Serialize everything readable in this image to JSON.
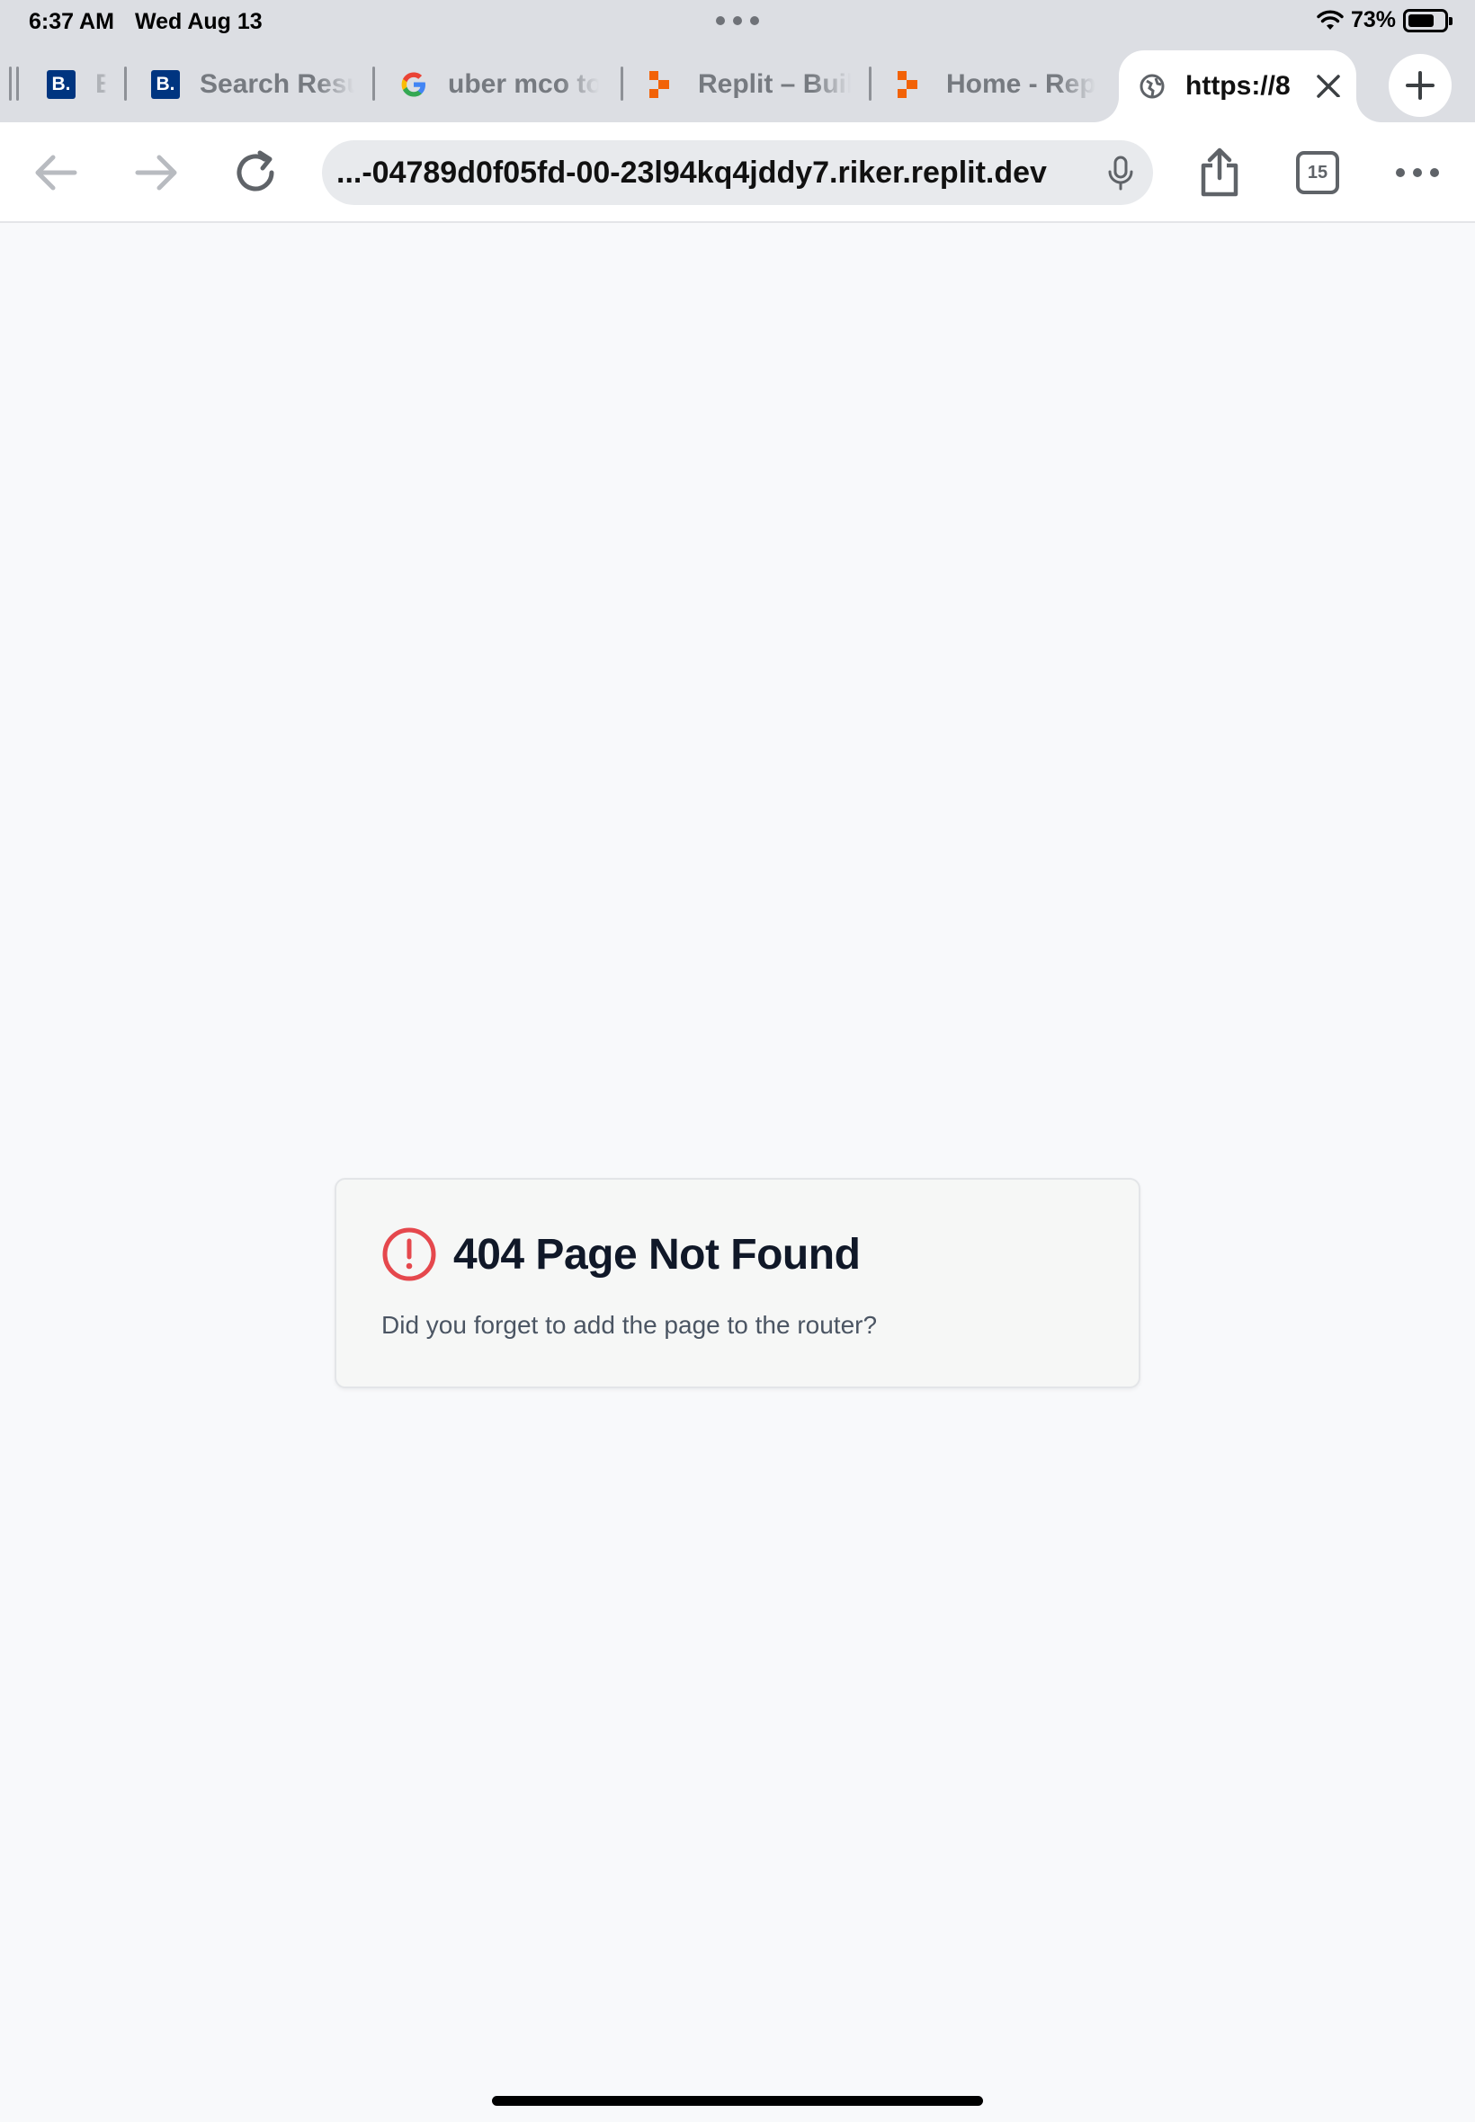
{
  "status_bar": {
    "time": "6:37 AM",
    "date": "Wed Aug 13",
    "battery": "73%",
    "battery_level": 0.73
  },
  "tabs": [
    {
      "title": "B",
      "favicon": "booking-b-icon",
      "favicon_text": "B."
    },
    {
      "title": "Search Resu",
      "favicon": "booking-b-icon",
      "favicon_text": "B."
    },
    {
      "title": "uber mco to",
      "favicon": "google-g-icon"
    },
    {
      "title": "Replit – Buil",
      "favicon": "replit-icon"
    },
    {
      "title": "Home - Repl",
      "favicon": "replit-icon"
    }
  ],
  "active_tab": {
    "title": "https://8",
    "favicon": "globe-icon"
  },
  "toolbar": {
    "url": "...-04789d0f05fd-00-23l94kq4jddy7.riker.replit.dev",
    "tab_count": "15"
  },
  "page": {
    "title": "404 Page Not Found",
    "description": "Did you forget to add the page to the router?"
  },
  "colors": {
    "alert": "#e5484d",
    "title": "#101828",
    "chrome": "#dcdee3"
  }
}
